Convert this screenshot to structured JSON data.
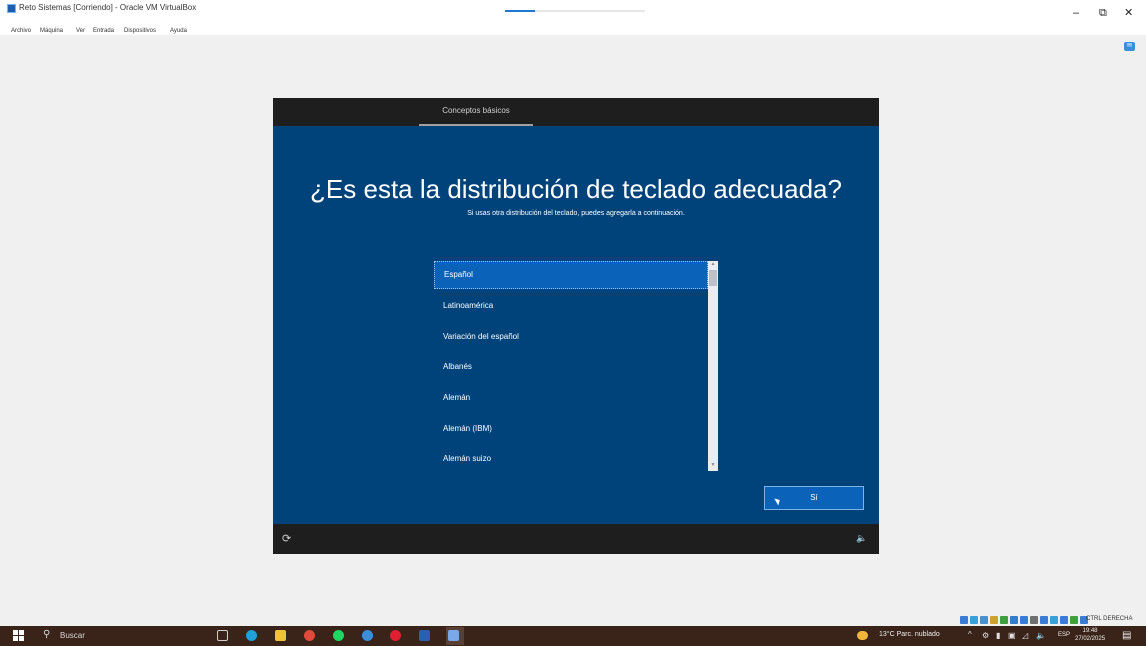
{
  "window": {
    "title": "Reto Sistemas [Corriendo] - Oracle VM VirtualBox",
    "minimize": "–",
    "restore": "⧉",
    "close": "✕"
  },
  "menu": [
    "Archivo",
    "Máquina",
    "Ver",
    "Entrada",
    "Dispositivos",
    "Ayuda"
  ],
  "vm": {
    "tab": "Conceptos básicos",
    "heading": "¿Es esta la distribución de teclado adecuada?",
    "subheading": "Si usas otra distribución del teclado, puedes agregarla a continuación.",
    "layouts": [
      "Español",
      "Latinoamérica",
      "Variación del español",
      "Albanés",
      "Alemán",
      "Alemán (IBM)",
      "Alemán suizo"
    ],
    "selected_index": 0,
    "yes_button": "Sí",
    "accessibility_icon": "accessibility-icon",
    "volume_icon": "volume-icon"
  },
  "vbox_status": {
    "host_key": "CTRL DERECHA",
    "icon_colors": [
      "#3a7bd5",
      "#3aa0d5",
      "#4c8fd0",
      "#d0a030",
      "#40a040",
      "#2f7fd0",
      "#3a7bd5",
      "#707070",
      "#3a7bd5",
      "#3aa0d5",
      "#3a7bd5",
      "#40a040",
      "#3a7bd5"
    ]
  },
  "taskbar": {
    "search_label": "Buscar",
    "apps": [
      {
        "name": "task-view-icon",
        "color": "#cfcfcf"
      },
      {
        "name": "edge-icon",
        "color": "#1fa0d8"
      },
      {
        "name": "file-explorer-icon",
        "color": "#f0c23a"
      },
      {
        "name": "chrome-icon",
        "color": "#e04a3a"
      },
      {
        "name": "spotify-icon",
        "color": "#1ed760"
      },
      {
        "name": "chrome-alt-icon",
        "color": "#3a8ee0"
      },
      {
        "name": "opera-icon",
        "color": "#e02030"
      },
      {
        "name": "word-icon",
        "color": "#2b5fb0"
      },
      {
        "name": "virtualbox-icon",
        "color": "#7aa8e8"
      }
    ],
    "weather": "13°C Parc. nublado",
    "tray_chevron": "^",
    "language": "ESP",
    "time": "19:48",
    "date": "27/02/2025"
  }
}
